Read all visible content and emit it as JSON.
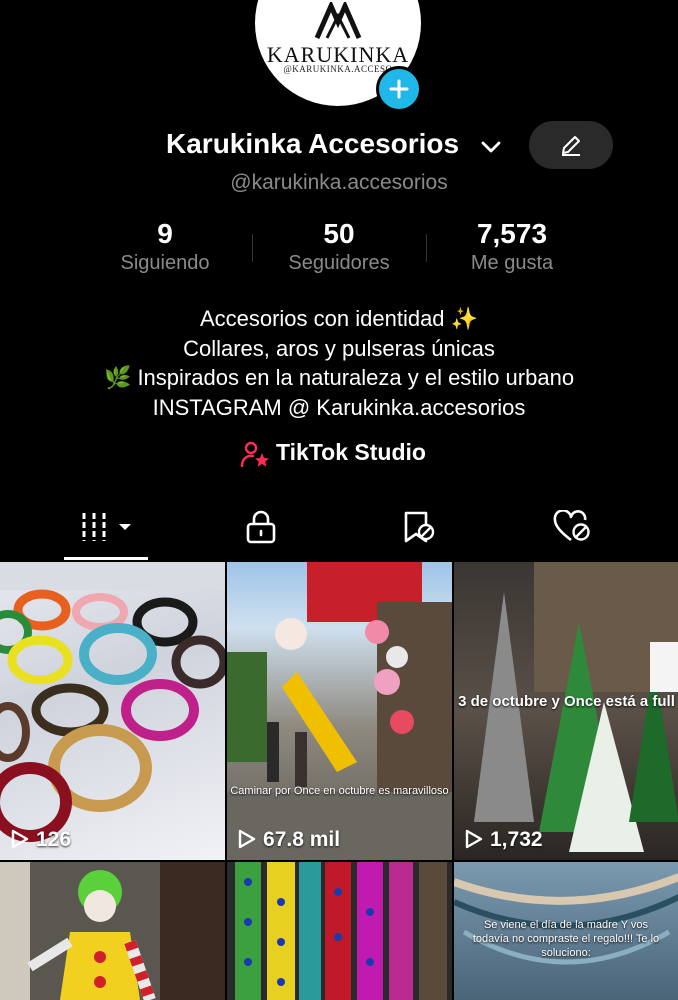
{
  "profile": {
    "avatar_brand": "KARUKINKA",
    "avatar_sub": "@KARUKINKA.ACCESO",
    "display_name": "Karukinka Accesorios",
    "handle": "@karukinka.accesorios"
  },
  "stats": [
    {
      "value": "9",
      "label": "Siguiendo"
    },
    {
      "value": "50",
      "label": "Seguidores"
    },
    {
      "value": "7,573",
      "label": "Me gusta"
    }
  ],
  "bio": [
    "Accesorios con identidad ✨",
    "Collares, aros y pulseras únicas",
    "🌿 Inspirados en la naturaleza y el estilo urbano",
    "INSTAGRAM @ Karukinka.accesorios"
  ],
  "studio_label": "TikTok Studio",
  "tabs": [
    {
      "icon": "grid-icon"
    },
    {
      "icon": "lock-icon"
    },
    {
      "icon": "bookmark-icon"
    },
    {
      "icon": "liked-icon"
    }
  ],
  "videos": [
    {
      "views": "126",
      "caption": ""
    },
    {
      "views": "67.8 mil",
      "caption": "Caminar por Once en octubre es maravilloso"
    },
    {
      "views": "1,732",
      "caption": "3 de octubre y Once está a full"
    },
    {
      "views": "",
      "caption": ""
    },
    {
      "views": "",
      "caption": ""
    },
    {
      "views": "",
      "caption": "Se viene el día de la madre Y vos todavía no compraste el regalo!!! Te lo soluciono:"
    }
  ],
  "colors": {
    "accent": "#20b8e8",
    "studio_icon": "#fe2c55"
  }
}
